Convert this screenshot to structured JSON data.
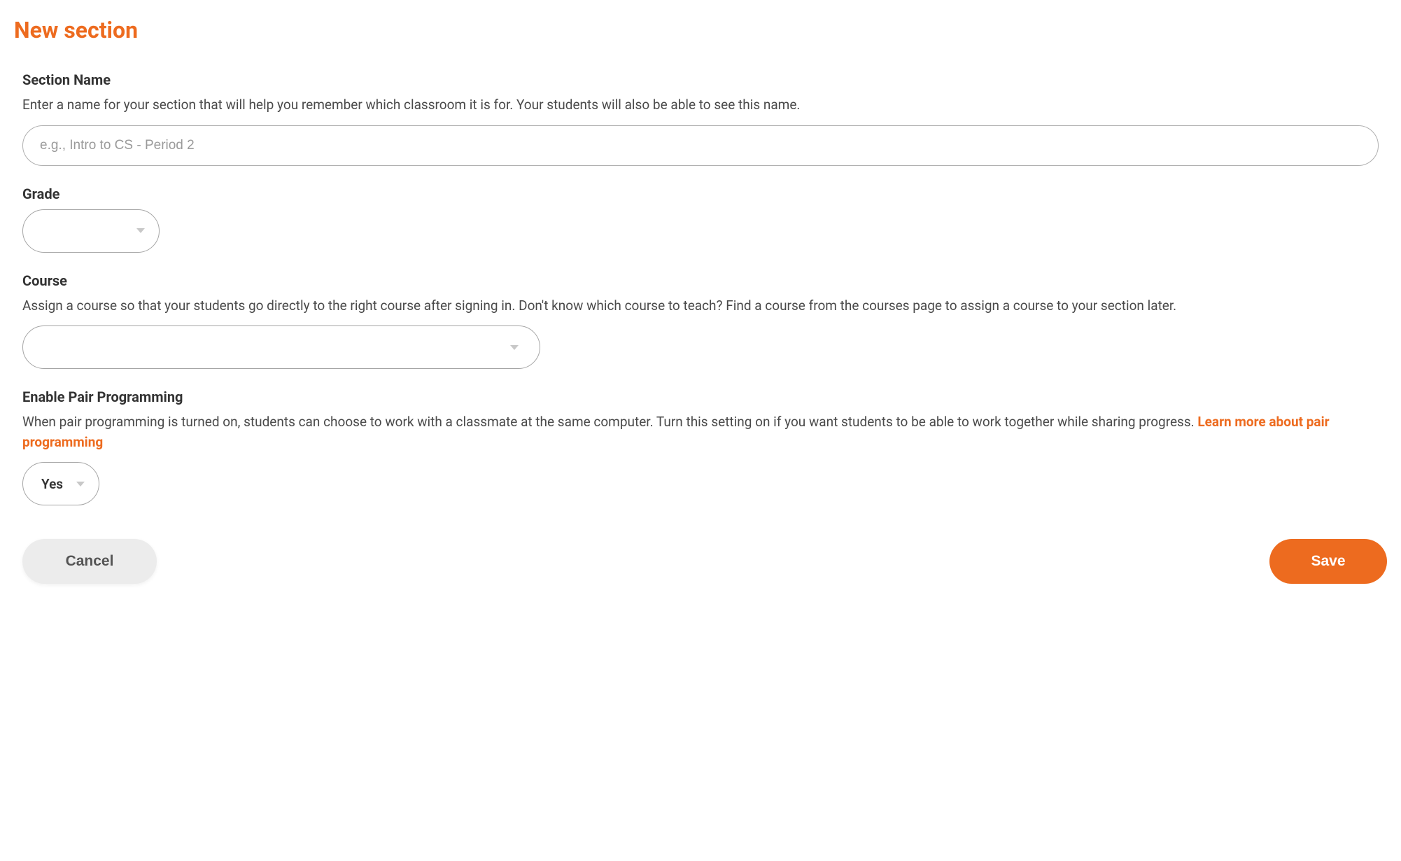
{
  "page": {
    "title": "New section"
  },
  "sectionName": {
    "label": "Section Name",
    "description": "Enter a name for your section that will help you remember which classroom it is for. Your students will also be able to see this name.",
    "placeholder": "e.g., Intro to CS - Period 2",
    "value": ""
  },
  "grade": {
    "label": "Grade",
    "value": ""
  },
  "course": {
    "label": "Course",
    "description": "Assign a course so that your students go directly to the right course after signing in. Don't know which course to teach? Find a course from the courses page to assign a course to your section later.",
    "value": ""
  },
  "pairProgramming": {
    "label": "Enable Pair Programming",
    "descriptionPrefix": "When pair programming is turned on, students can choose to work with a classmate at the same computer. Turn this setting on if you want students to be able to work together while sharing progress. ",
    "linkText": "Learn more about pair programming",
    "value": "Yes"
  },
  "buttons": {
    "cancel": "Cancel",
    "save": "Save"
  }
}
